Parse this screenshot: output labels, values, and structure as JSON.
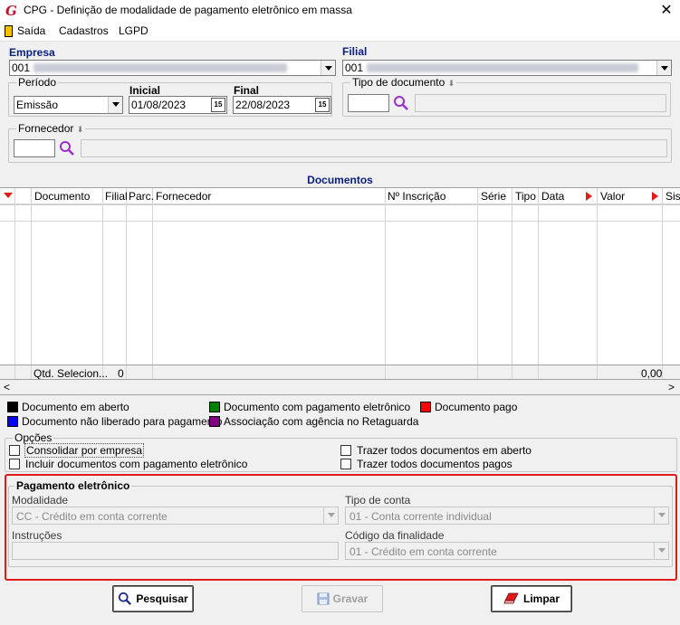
{
  "window": {
    "title": "CPG - Definição de modalidade de pagamento eletrônico em massa"
  },
  "menu": {
    "items": [
      "Saída",
      "Cadastros",
      "LGPD"
    ]
  },
  "empresa": {
    "label": "Empresa",
    "value": "001"
  },
  "filial": {
    "label": "Filial",
    "value": "001"
  },
  "periodo": {
    "label": "Período",
    "type_value": "Emissão",
    "inicial_label": "Inicial",
    "inicial_value": "01/08/2023",
    "final_label": "Final",
    "final_value": "22/08/2023",
    "calendar_glyph": "15"
  },
  "tipo_documento": {
    "label": "Tipo de documento",
    "value": ""
  },
  "fornecedor": {
    "label": "Fornecedor",
    "value": ""
  },
  "documentos": {
    "title": "Documentos",
    "columns": [
      "Documento",
      "Filial",
      "Parc.",
      "Fornecedor",
      "Nº Inscrição",
      "Série",
      "Tipo",
      "Data",
      "Valor",
      "Sis"
    ],
    "footer_label": "Qtd. Selecion...",
    "footer_count": "0",
    "footer_value": "0,00"
  },
  "legend": [
    {
      "label": "Documento em aberto",
      "color": "#000000"
    },
    {
      "label": "Documento com pagamento eletrônico",
      "color": "#008000"
    },
    {
      "label": "Documento pago",
      "color": "#ff0000"
    },
    {
      "label": "Documento não liberado para pagamento",
      "color": "#0000ff"
    },
    {
      "label": "Associação com agência no Retaguarda",
      "color": "#800080"
    }
  ],
  "opcoes": {
    "label": "Opções",
    "items": [
      "Consolidar por empresa",
      "Incluir documentos com pagamento eletrônico",
      "Trazer todos documentos em aberto",
      "Trazer todos documentos pagos"
    ]
  },
  "pagamento": {
    "title": "Pagamento eletrônico",
    "modalidade_label": "Modalidade",
    "modalidade_value": "CC   - Crédito em conta corrente",
    "tipo_conta_label": "Tipo de conta",
    "tipo_conta_value": "01 - Conta corrente individual",
    "instrucoes_label": "Instruções",
    "instrucoes_value": "",
    "finalidade_label": "Código da finalidade",
    "finalidade_value": "01 - Crédito em conta corrente"
  },
  "buttons": {
    "pesquisar": "Pesquisar",
    "gravar": "Gravar",
    "limpar": "Limpar"
  },
  "colors": {
    "accent_blue": "#0a2080",
    "highlight_red": "#e01b1b",
    "logo_red": "#c8102e"
  }
}
